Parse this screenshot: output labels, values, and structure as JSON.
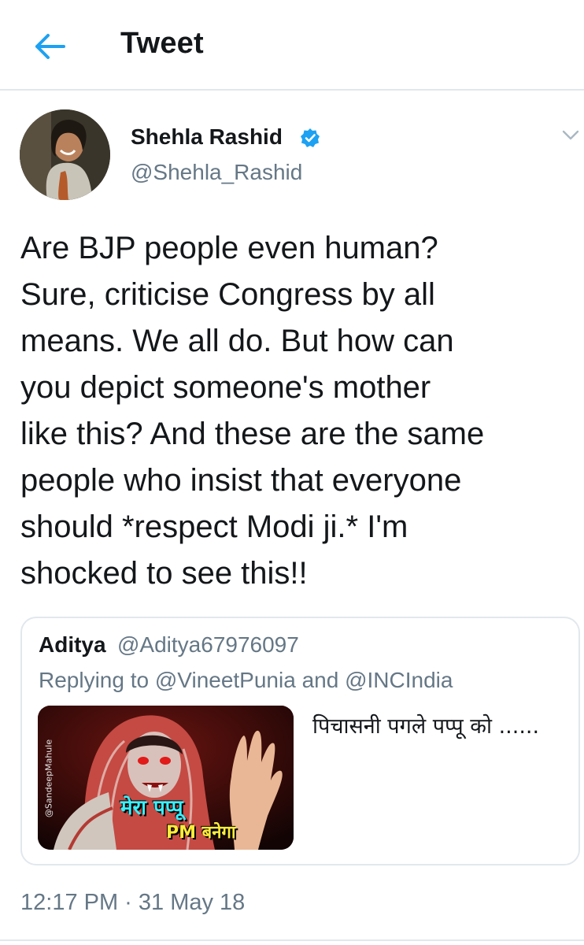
{
  "header": {
    "title": "Tweet",
    "back_icon": "back-arrow-icon",
    "accent": "#1da1f2"
  },
  "tweet": {
    "author_name": "Shehla Rashid",
    "handle": "@Shehla_Rashid",
    "verified": true,
    "text": "Are BJP people even human?\nSure, criticise Congress by all\nmeans. We all do. But how can\nyou depict someone's mother\nlike this? And these are the same\npeople who insist that everyone\nshould *respect Modi ji.* I'm\nshocked to see this!!",
    "timestamp": "12:17 PM · 31 May 18"
  },
  "quoted_tweet": {
    "author_name": "Aditya",
    "handle": "@Aditya67976097",
    "replying_prefix": "Replying to ",
    "reply_to_1": "@VineetPunia",
    "reply_and": " and ",
    "reply_to_2": "@INCIndia",
    "text": "पिचासनी पगले पप्पू को ......",
    "image": {
      "caption_line1": "मेरा पप्पू",
      "caption_line2": "PM बनेगा",
      "watermark": "@SandeepMahule"
    }
  }
}
